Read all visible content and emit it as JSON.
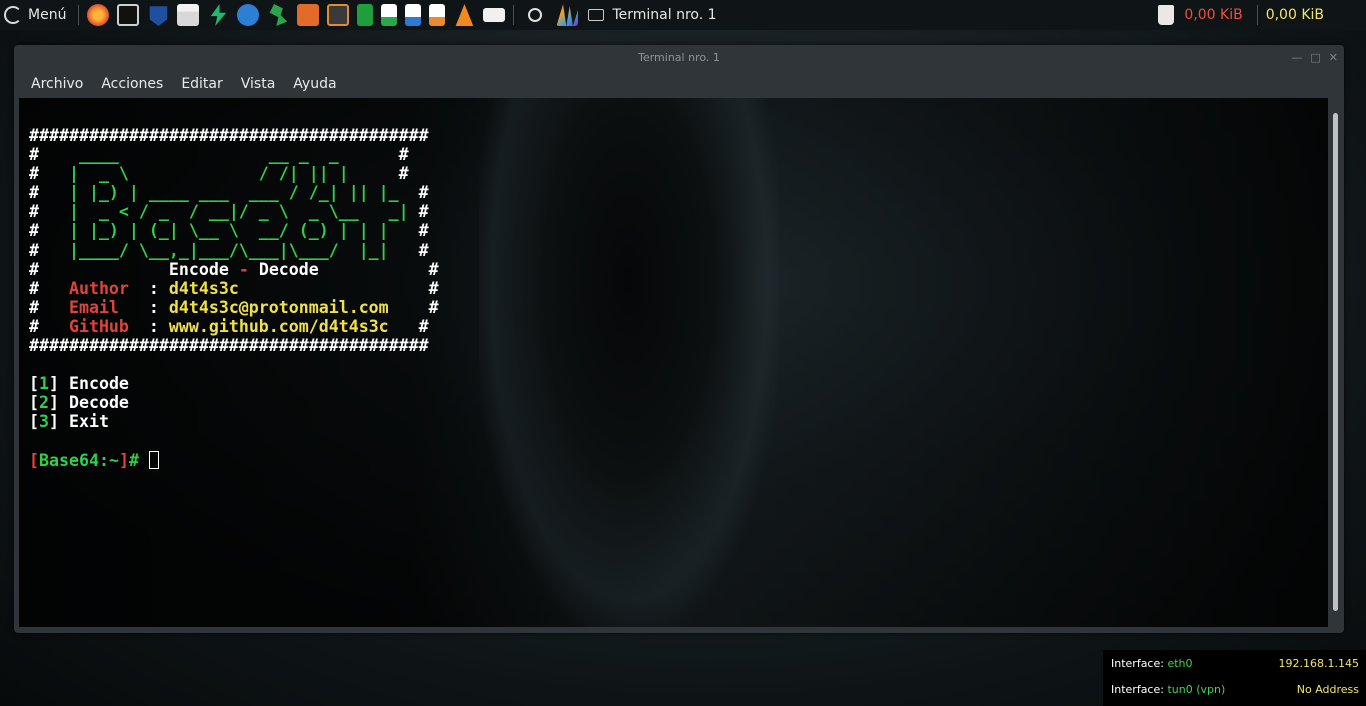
{
  "taskbar": {
    "menu_label": "Menú",
    "task_title": "Terminal nro. 1",
    "net_down": "0,00  KiB",
    "net_up": "0,00  KiB",
    "launchers": [
      "firefox-icon",
      "terminal-icon",
      "metasploit-icon",
      "files-icon",
      "zap-icon",
      "wireshark-icon",
      "lizard-icon",
      "burp-icon",
      "sublime-icon",
      "calc-sheet-icon",
      "writer-icon",
      "docs-icon",
      "impress-icon",
      "vlc-icon",
      "camera-icon"
    ]
  },
  "window": {
    "title": "Terminal nro. 1",
    "menu": [
      "Archivo",
      "Acciones",
      "Editar",
      "Vista",
      "Ayuda"
    ]
  },
  "terminal": {
    "border": "########################################",
    "art": [
      "  ____               __ _  _   ",
      " | __ )  __ _ ___  / /_| || |  ",
      " |  _ \\ / _` / __|| '_ \\ || |_ ",
      " | |_) | (_| \\__ \\| (_) |__   _|",
      " |____/ \\__,_|___/ \\___/   |_|  ",
      "                                "
    ],
    "banner_rows": [
      "#   ____               __ _  _    #",
      "#  |  _ \\             / /| || |   #",
      "#  | |_) | ____ ___  ___ / /_| || |_  #",
      "#  |  _ < / _  / __|/ _ \\  _ \\__   _| #",
      "#  | |_) | (_| \\__ \\  __/ (_) | | |   #",
      "#  |____/ \\__,_|___/\\___|\\___/  |_|   #"
    ],
    "art_lines": [
      "  ____               __ _  _    ",
      " |  _ \\             / /| || |   ",
      " | |_) | ____ ___  ___ / /_| || |_  ",
      " |  _ < / _  / __|/ _ \\  _ \\__   _| ",
      " | |_) | (_| \\__ \\  __/ (_) | | |   ",
      " |____/ \\__,_|___/\\___|\\___/  |_|   "
    ],
    "subtitle_left": "Encode",
    "subtitle_dash": "-",
    "subtitle_right": "Decode",
    "author_label": "Author",
    "author_value": "d4t4s3c",
    "email_label": "Email",
    "email_value": "d4t4s3c@protonmail.com",
    "github_label": "GitHub",
    "github_value": "www.github.com/d4t4s3c",
    "options": [
      {
        "num": "1",
        "label": "Encode"
      },
      {
        "num": "2",
        "label": "Decode"
      },
      {
        "num": "3",
        "label": "Exit"
      }
    ],
    "prompt_name": "Base64",
    "prompt_path": ":~",
    "prompt_symbol": "#"
  },
  "conky": {
    "iface1_label": "Interface: ",
    "iface1_name": "eth0",
    "iface1_ip": "192.168.1.145",
    "iface2_label": "Interface: ",
    "iface2_name": "tun0 (vpn)",
    "iface2_ip": "No Address"
  },
  "colors": {
    "green": "#2fd14a",
    "red": "#e0433a",
    "yellow": "#f0e14a"
  }
}
